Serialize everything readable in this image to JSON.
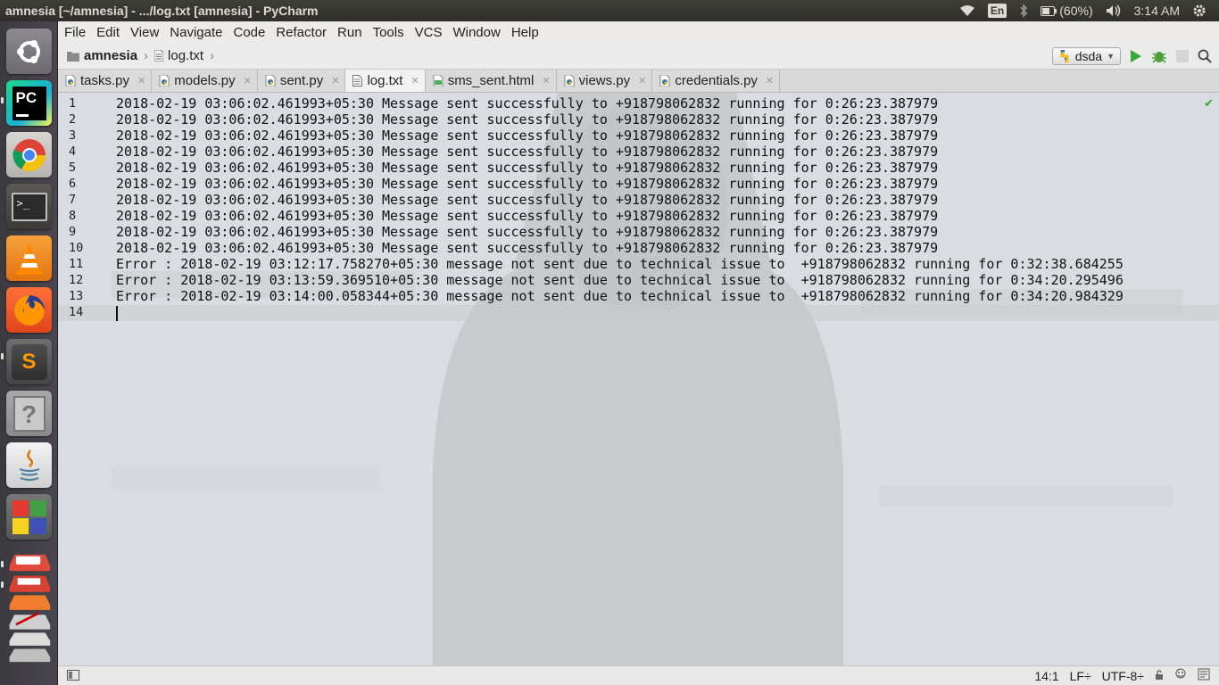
{
  "window_title": "amnesia [~/amnesia] - .../log.txt [amnesia] - PyCharm",
  "tray": {
    "wifi_icon": "wifi-icon",
    "keyboard_layout": "En",
    "bluetooth_icon": "bluetooth-icon",
    "battery": "(60%)",
    "volume_icon": "volume-icon",
    "time": "3:14 AM",
    "settings_icon": "gear-icon"
  },
  "launcher": {
    "items": [
      {
        "name": "ubuntu-dash",
        "icon": "ubuntu-logo-icon"
      },
      {
        "name": "pycharm",
        "icon": "pycharm-icon",
        "label": "PC"
      },
      {
        "name": "chrome",
        "icon": "chrome-icon"
      },
      {
        "name": "terminal",
        "icon": "terminal-icon",
        "label": ">_"
      },
      {
        "name": "vlc",
        "icon": "vlc-cone-icon"
      },
      {
        "name": "firefox",
        "icon": "firefox-icon"
      },
      {
        "name": "sublime",
        "icon": "sublime-text-icon",
        "label": "S"
      },
      {
        "name": "unknown-app",
        "icon": "question-mark-icon",
        "label": "?"
      },
      {
        "name": "java",
        "icon": "java-icon"
      },
      {
        "name": "blocks",
        "icon": "blocks-icon"
      },
      {
        "name": "stacked-apps",
        "icon": "stacked-apps-icon"
      }
    ]
  },
  "menubar": {
    "items": [
      "File",
      "Edit",
      "View",
      "Navigate",
      "Code",
      "Refactor",
      "Run",
      "Tools",
      "VCS",
      "Window",
      "Help"
    ]
  },
  "navbar": {
    "project": "amnesia",
    "file": "log.txt",
    "run_config": "dsda",
    "icons": [
      "run-icon",
      "debug-icon",
      "stop-icon",
      "search-icon"
    ]
  },
  "tabs": [
    {
      "label": "tasks.py",
      "icon": "python-file-icon",
      "active": false
    },
    {
      "label": "models.py",
      "icon": "python-file-icon",
      "active": false
    },
    {
      "label": "sent.py",
      "icon": "python-file-icon",
      "active": false
    },
    {
      "label": "log.txt",
      "icon": "text-file-icon",
      "active": true
    },
    {
      "label": "sms_sent.html",
      "icon": "html-file-icon",
      "active": false
    },
    {
      "label": "views.py",
      "icon": "python-file-icon",
      "active": false
    },
    {
      "label": "credentials.py",
      "icon": "python-file-icon",
      "active": false
    }
  ],
  "editor": {
    "line_numbers": [
      "1",
      "2",
      "3",
      "4",
      "5",
      "6",
      "7",
      "8",
      "9",
      "10",
      "11",
      "12",
      "13",
      "14"
    ],
    "lines": [
      "2018-02-19 03:06:02.461993+05:30 Message sent successfully to +918798062832 running for 0:26:23.387979",
      "2018-02-19 03:06:02.461993+05:30 Message sent successfully to +918798062832 running for 0:26:23.387979",
      "2018-02-19 03:06:02.461993+05:30 Message sent successfully to +918798062832 running for 0:26:23.387979",
      "2018-02-19 03:06:02.461993+05:30 Message sent successfully to +918798062832 running for 0:26:23.387979",
      "2018-02-19 03:06:02.461993+05:30 Message sent successfully to +918798062832 running for 0:26:23.387979",
      "2018-02-19 03:06:02.461993+05:30 Message sent successfully to +918798062832 running for 0:26:23.387979",
      "2018-02-19 03:06:02.461993+05:30 Message sent successfully to +918798062832 running for 0:26:23.387979",
      "2018-02-19 03:06:02.461993+05:30 Message sent successfully to +918798062832 running for 0:26:23.387979",
      "2018-02-19 03:06:02.461993+05:30 Message sent successfully to +918798062832 running for 0:26:23.387979",
      "2018-02-19 03:06:02.461993+05:30 Message sent successfully to +918798062832 running for 0:26:23.387979",
      "Error : 2018-02-19 03:12:17.758270+05:30 message not sent due to technical issue to  +918798062832 running for 0:32:38.684255",
      "Error : 2018-02-19 03:13:59.369510+05:30 message not sent due to technical issue to  +918798062832 running for 0:34:20.295496",
      "Error : 2018-02-19 03:14:00.058344+05:30 message not sent due to technical issue to  +918798062832 running for 0:34:20.984329",
      ""
    ],
    "inspection_icon": "check-mark-icon"
  },
  "statusbar": {
    "layout_icon": "tool-window-toggle-icon",
    "position": "14:1",
    "line_separator": "LF÷",
    "encoding": "UTF-8÷",
    "icons": [
      "lock-icon",
      "inspector-icon",
      "event-log-icon"
    ]
  },
  "colors": {
    "accent_green": "#3ca03c",
    "launcher_bg": "#3b3a3e",
    "top_panel": "#3f3e39"
  }
}
